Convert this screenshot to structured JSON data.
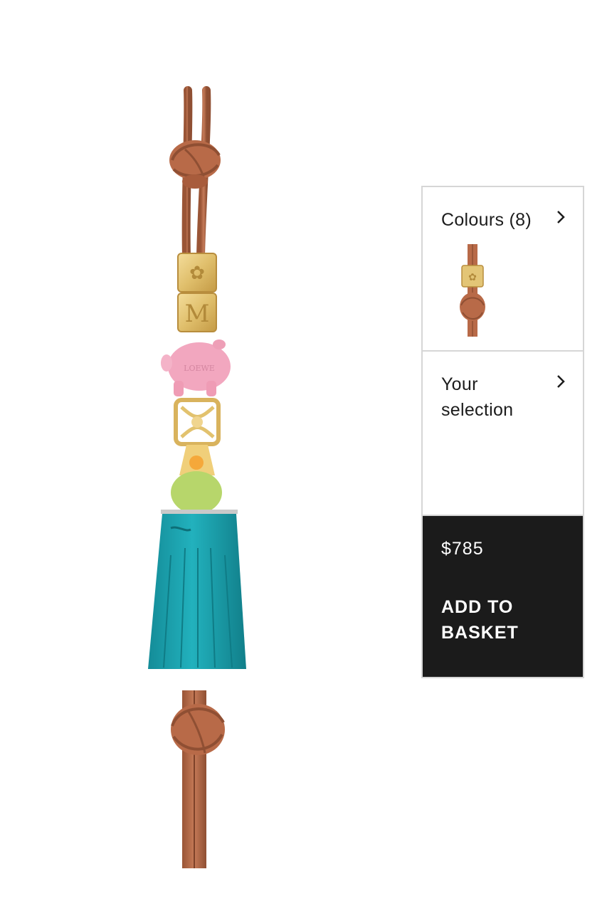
{
  "product": {
    "image_alt": "Leather charm with pig, bird, cube beads and teal tassel",
    "cube_letter": "M",
    "brand_engraving": "LOEWE"
  },
  "panel": {
    "colours_label": "Colours (8)",
    "selection_label": "Your selection",
    "price": "$785",
    "add_to_basket_label": "ADD TO BASKET"
  },
  "colors": {
    "leather": "#b86a48",
    "leather_dark": "#8f4f33",
    "gold": "#e3c576",
    "pig_pink": "#f2a7bf",
    "bird_green": "#b7d66b",
    "bird_yellow": "#f0cf7a",
    "tassel_teal": "#1fa7b4",
    "button_bg": "#1b1b1b",
    "border": "#d6d6d6"
  },
  "icons": [
    "chevron-right-icon",
    "chevron-right-icon"
  ]
}
